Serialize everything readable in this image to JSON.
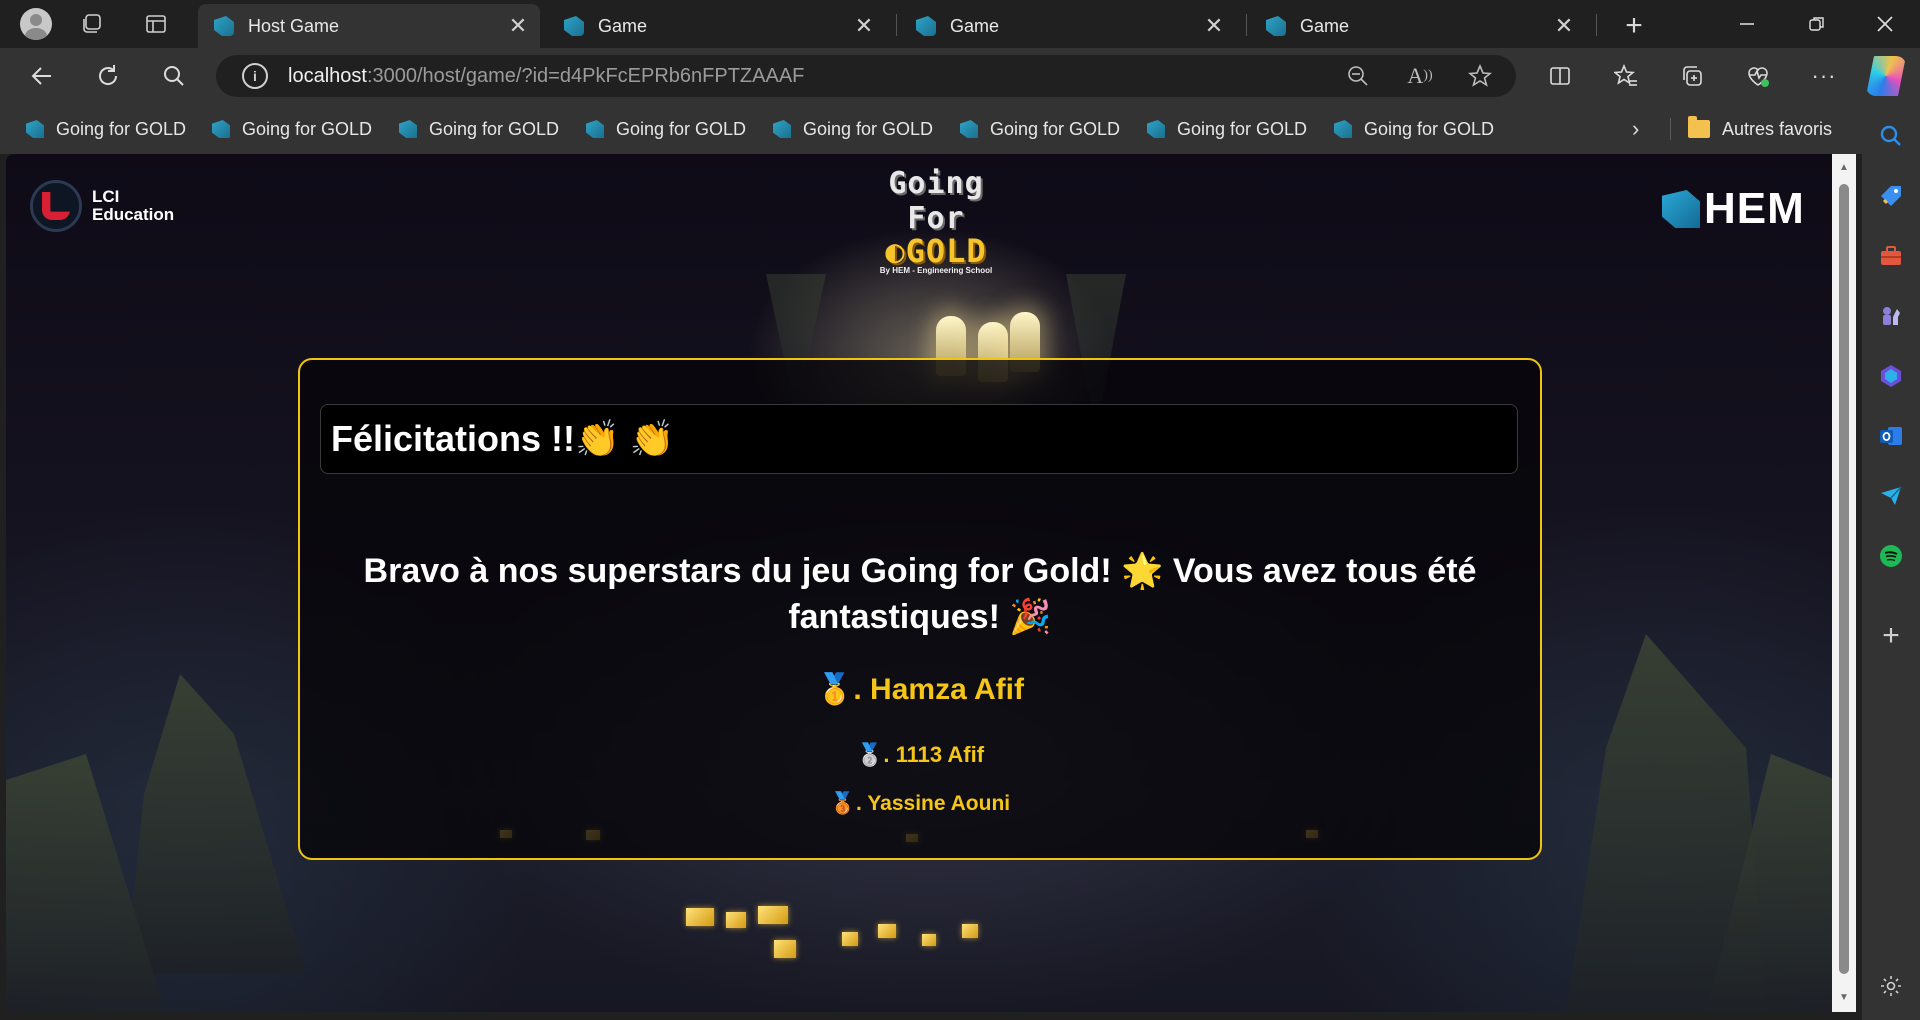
{
  "browser": {
    "tabs": [
      {
        "title": "Host Game",
        "active": true
      },
      {
        "title": "Game",
        "active": false
      },
      {
        "title": "Game",
        "active": false
      },
      {
        "title": "Game",
        "active": false
      }
    ],
    "address": {
      "host": "localhost",
      "path": ":3000/host/game/?id=d4PkFcEPRb6nFPTZAAAF"
    },
    "favorites": [
      "Going for GOLD",
      "Going for GOLD",
      "Going for GOLD",
      "Going for GOLD",
      "Going for GOLD",
      "Going for GOLD",
      "Going for GOLD",
      "Going for GOLD"
    ],
    "other_favorites": "Autres favoris",
    "icons": {
      "close": "✕",
      "newtab": "+",
      "more_favs": "›"
    }
  },
  "page": {
    "logos": {
      "lci_line1": "LCI",
      "lci_line2": "Education",
      "gfg_top": "Going For",
      "gfg_gold": "◐GOLD",
      "gfg_sub": "By HEM - Engineering School",
      "hem": "HEM"
    },
    "card": {
      "header": "Félicitations !!👏 👏",
      "message": "Bravo à nos superstars du jeu Going for Gold! 🌟 Vous avez tous été fantastiques! 🎉",
      "winners": [
        {
          "medal": "🥇",
          "text": ". Hamza Afif"
        },
        {
          "medal": "🥈",
          "text": ". 1113 Afif"
        },
        {
          "medal": "🥉",
          "text": ". Yassine Aouni"
        }
      ]
    }
  },
  "colors": {
    "accent_gold": "#f5c518",
    "card_border": "#f1c40f",
    "browser_dark": "#202020",
    "browser_toolbar": "#333333"
  }
}
